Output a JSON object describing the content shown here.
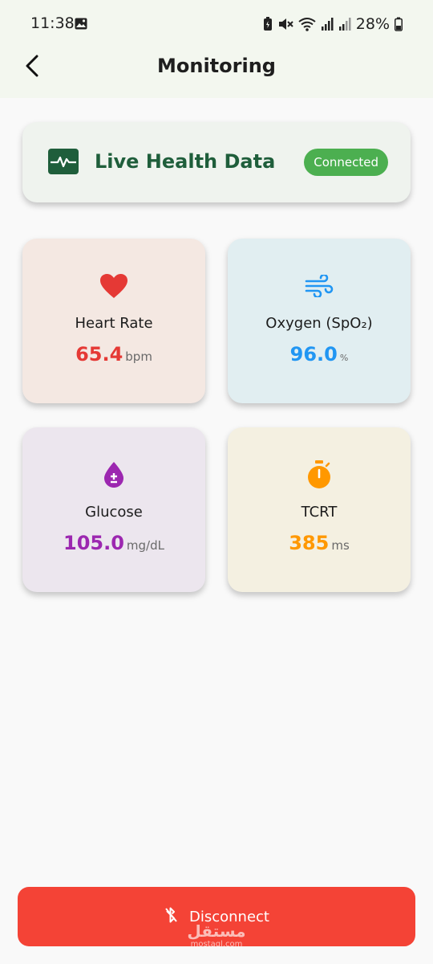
{
  "status_bar": {
    "time": "11:38",
    "battery_percent": "28%",
    "icons": [
      "image-icon",
      "battery-saver-icon",
      "mute-icon",
      "wifi-icon",
      "signal-icon",
      "signal-icon",
      "battery-icon"
    ]
  },
  "header": {
    "back_icon": "chevron-left-icon",
    "title": "Monitoring"
  },
  "live_card": {
    "icon": "heart-monitor-icon",
    "title": "Live Health Data",
    "status": "Connected",
    "status_color": "#4caf50"
  },
  "metrics": [
    {
      "id": "heart",
      "icon": "heart-icon",
      "label": "Heart Rate",
      "value": "65.4",
      "unit": "bpm",
      "color": "#e53935"
    },
    {
      "id": "oxygen",
      "icon": "air-icon",
      "label": "Oxygen (SpO₂)",
      "value": "96.0",
      "unit": "%",
      "color": "#2196f3"
    },
    {
      "id": "glucose",
      "icon": "blood-drop-icon",
      "label": "Glucose",
      "value": "105.0",
      "unit": "mg/dL",
      "color": "#9c27b0"
    },
    {
      "id": "tcrt",
      "icon": "stopwatch-icon",
      "label": "TCRT",
      "value": "385",
      "unit": "ms",
      "color": "#ff9800"
    }
  ],
  "footer": {
    "disconnect_label": "Disconnect",
    "disconnect_icon": "bluetooth-disabled-icon",
    "button_color": "#f44336"
  },
  "watermark": {
    "arabic": "مستقل",
    "latin": "mostaql.com"
  }
}
